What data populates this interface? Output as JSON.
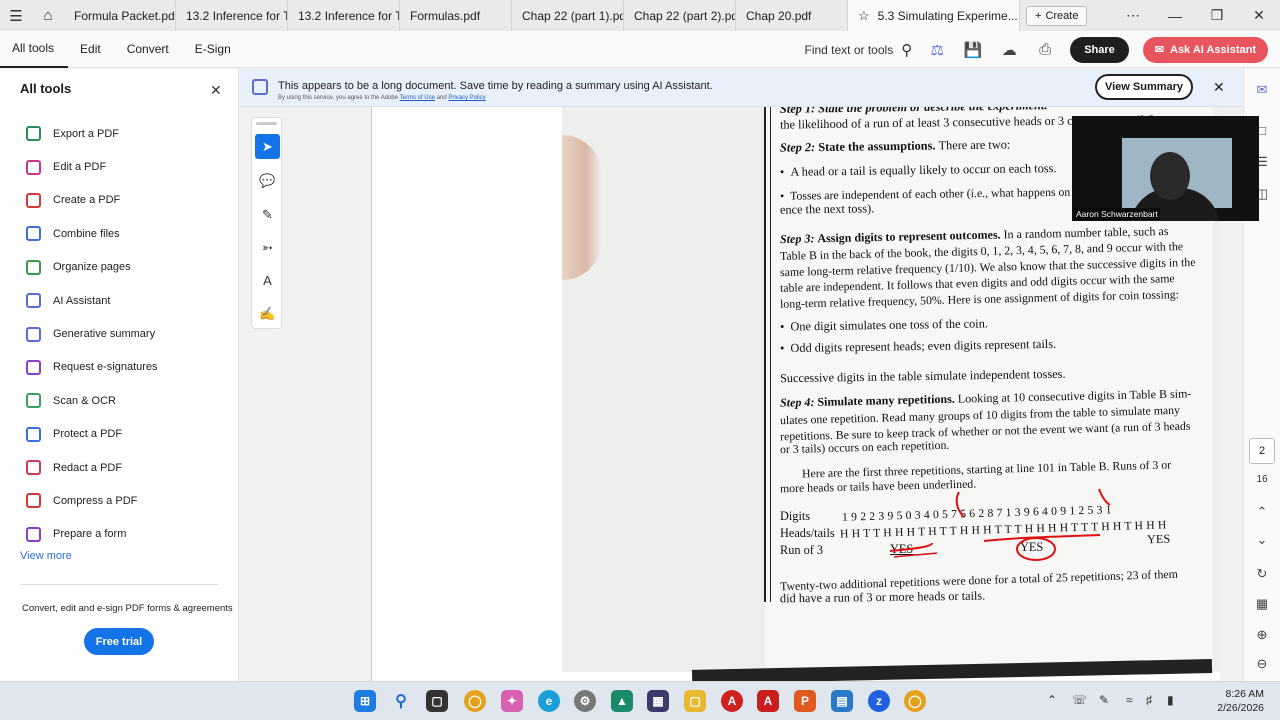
{
  "tabs": [
    {
      "label": "Formula Packet.pdf",
      "active": false
    },
    {
      "label": "13.2 Inference for T...",
      "active": false
    },
    {
      "label": "13.2 Inference for T...",
      "active": false
    },
    {
      "label": "Formulas.pdf",
      "active": false
    },
    {
      "label": "Chap 22 (part 1).pdf",
      "active": false
    },
    {
      "label": "Chap 22 (part 2).pdf",
      "active": false
    },
    {
      "label": "Chap 20.pdf",
      "active": false
    },
    {
      "label": "5.3 Simulating Experime...",
      "active": true
    }
  ],
  "create_label": "Create",
  "menu": {
    "all_tools": "All tools",
    "edit": "Edit",
    "convert": "Convert",
    "esign": "E-Sign",
    "find": "Find text or tools",
    "share": "Share",
    "ask_ai": "Ask AI Assistant"
  },
  "left_panel": {
    "title": "All tools",
    "items": [
      {
        "label": "Export a PDF",
        "color": "#2c8c5a"
      },
      {
        "label": "Edit a PDF",
        "color": "#c8358a"
      },
      {
        "label": "Create a PDF",
        "color": "#d23a3a"
      },
      {
        "label": "Combine files",
        "color": "#3f6fd8"
      },
      {
        "label": "Organize pages",
        "color": "#3a9a4a"
      },
      {
        "label": "AI Assistant",
        "color": "#5b6bd8"
      },
      {
        "label": "Generative summary",
        "color": "#5b6bd8"
      },
      {
        "label": "Request e-signatures",
        "color": "#8a3fc8"
      },
      {
        "label": "Scan & OCR",
        "color": "#3aa060"
      },
      {
        "label": "Protect a PDF",
        "color": "#3f6fd8"
      },
      {
        "label": "Redact a PDF",
        "color": "#c83a5a"
      },
      {
        "label": "Compress a PDF",
        "color": "#d23a3a"
      },
      {
        "label": "Prepare a form",
        "color": "#8a3fc8"
      }
    ],
    "view_more": "View more",
    "promo": "Convert, edit and e-sign PDF forms & agreements",
    "free_trial": "Free trial"
  },
  "banner": {
    "text": "This appears to be a long document. Save time by reading a summary using AI Assistant.",
    "fine_prefix": "By using this service, you agree to the Adobe",
    "terms": "Terms of Use",
    "and": "and",
    "privacy": "Privacy Policy",
    "view_summary": "View Summary"
  },
  "document": {
    "line_top": "Step 1:  State the problem or describe the experiment.",
    "line_1": "the likelihood of a run of at least 3 consecutive heads or 3 consecutive tails?",
    "step2_head": "Step 2:",
    "step2_bold": "State the assumptions.",
    "step2_rest": "There are two:",
    "bullet_1": "A head or a tail is equally likely to occur on each toss.",
    "bullet_2a": "Tosses are independent of each other (i.e., what happens on one toss will not influ-",
    "bullet_2b": "ence the next toss).",
    "step3_head": "Step 3:",
    "step3_bold": "Assign digits to represent outcomes.",
    "step3_rest": "In a random number table, such as",
    "step3_l2": "Table B in the back of the book, the digits 0, 1, 2, 3, 4, 5, 6, 7, 8, and 9 occur with the",
    "step3_l3": "same long-term relative frequency (1/10). We also know that the successive digits in the",
    "step3_l4": "table are independent. It follows that even digits and odd digits occur with the same",
    "step3_l5": "long-term relative frequency, 50%. Here is one assignment of digits for coin tossing:",
    "bullet_3": "One digit simulates one toss of the coin.",
    "bullet_4": "Odd digits represent heads; even digits represent tails.",
    "successive": "Successive digits in the table simulate independent tosses.",
    "step4_head": "Step 4:",
    "step4_bold": "Simulate many repetitions.",
    "step4_rest": "Looking at 10 consecutive digits in Table B sim-",
    "step4_l2": "ulates one repetition. Read many groups of 10 digits from the table to simulate many",
    "step4_l3": "repetitions. Be sure to keep track of whether or not the event we want (a run of 3 heads",
    "step4_l4": "or 3 tails) occurs on each repetition.",
    "here_l1": "Here are the first three repetitions, starting at line 101 in Table B. Runs of 3 or",
    "here_l2": "more heads or tails have been underlined.",
    "row_digits_label": "Digits",
    "row_digits": "1 9 2 2 3  9 5 0 3 4  0 5 7 5 6  2 8 7 1 3  9 6 4 0 9  1 2 5 3 1",
    "row_ht_label": "Heads/tails",
    "row_ht": "H H T T H H H T H T  T H H H T T T H H H  H T T T H H T H H H",
    "row_run_label": "Run of 3",
    "yes_1": "YES",
    "yes_2": "YES",
    "yes_3": "YES",
    "final_l1": "Twenty-two additional repetitions were done for a total of 25 repetitions; 23 of them",
    "final_l2": "did have a run of 3 or more heads or tails."
  },
  "video": {
    "name": "Aaron Schwarzenbart"
  },
  "right_rail": {
    "page": "2",
    "total": "16"
  },
  "clock": {
    "time": "8:26 AM",
    "date": "2/26/2026"
  }
}
